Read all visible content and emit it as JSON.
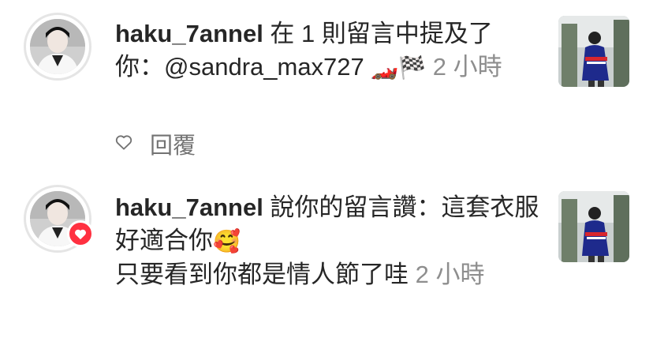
{
  "notifications": [
    {
      "username": "haku_7annel",
      "message": " 在 1 則留言中提及了你：@sandra_max727 ",
      "emoji": "🏎️🏁",
      "time": " 2 小時",
      "reply_label": "回覆",
      "icons": {
        "avatar": "profile-photo",
        "like": "heart-outline-icon",
        "thumbnail": "post-thumbnail"
      }
    },
    {
      "username": "haku_7annel",
      "message_line1": " 說你的留言讚：這套衣服好適合你",
      "emoji": "🥰",
      "message_line2": "只要看到你都是情人節了哇",
      "time": " 2 小時",
      "icons": {
        "avatar": "profile-photo",
        "badge": "heart-icon",
        "thumbnail": "post-thumbnail"
      }
    }
  ],
  "colors": {
    "text": "#262626",
    "muted": "#8e8e8e",
    "badge": "#ff3040",
    "avatar_ring": "#e5e5e5"
  }
}
